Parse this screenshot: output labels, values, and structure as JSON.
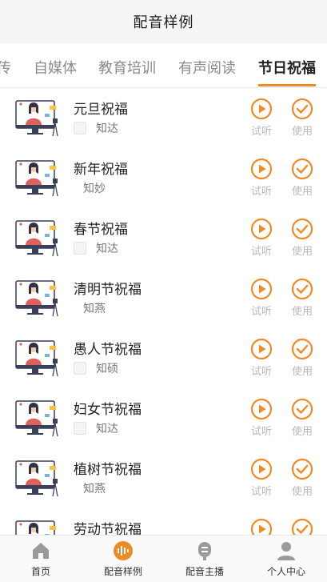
{
  "header": {
    "title": "配音样例"
  },
  "tabs": [
    {
      "label": "传"
    },
    {
      "label": "自媒体"
    },
    {
      "label": "教育培训"
    },
    {
      "label": "有声阅读"
    },
    {
      "label": "节日祝福"
    }
  ],
  "active_tab": "节日祝福",
  "samples": [
    {
      "title": "元旦祝福",
      "voice": "知达",
      "checkbox": true
    },
    {
      "title": "新年祝福",
      "voice": "知妙",
      "checkbox": false
    },
    {
      "title": "春节祝福",
      "voice": "知达",
      "checkbox": true
    },
    {
      "title": "清明节祝福",
      "voice": "知燕",
      "checkbox": false
    },
    {
      "title": "愚人节祝福",
      "voice": "知硕",
      "checkbox": true
    },
    {
      "title": "妇女节祝福",
      "voice": "知达",
      "checkbox": true
    },
    {
      "title": "植树节祝福",
      "voice": "知燕",
      "checkbox": false
    },
    {
      "title": "劳动节祝福",
      "voice": "",
      "checkbox": false
    }
  ],
  "actions": {
    "listen": "试听",
    "use": "使用"
  },
  "bottom_nav": [
    {
      "label": "首页",
      "icon": "home-icon"
    },
    {
      "label": "配音样例",
      "icon": "waveform-icon"
    },
    {
      "label": "配音主播",
      "icon": "anchor-icon"
    },
    {
      "label": "个人中心",
      "icon": "person-icon"
    }
  ],
  "colors": {
    "accent": "#f08a24",
    "muted": "#b9b9b9",
    "text": "#222222"
  }
}
